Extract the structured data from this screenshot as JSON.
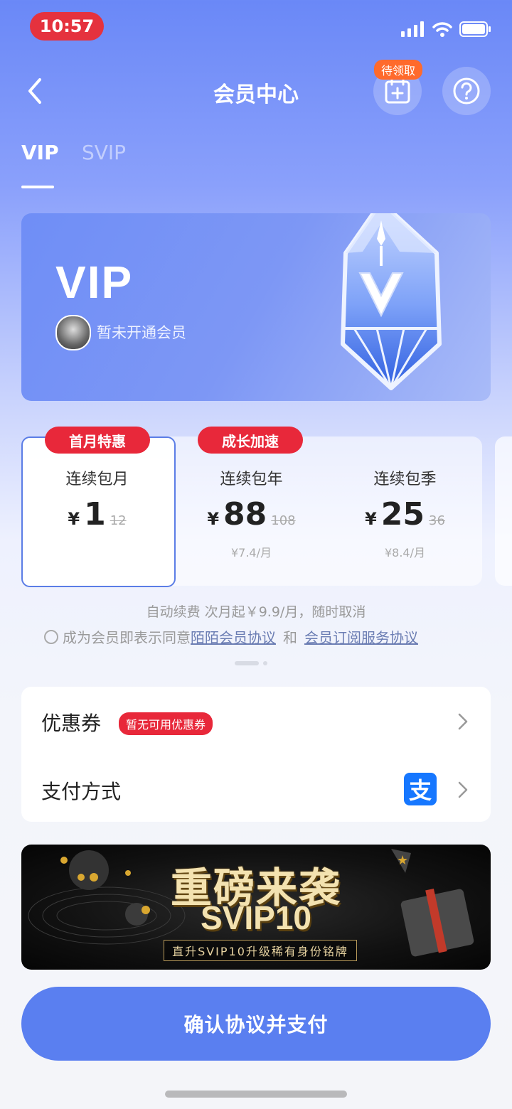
{
  "status_bar": {
    "time": "10:57"
  },
  "header": {
    "title": "会员中心",
    "pending_badge": "待领取"
  },
  "tabs": [
    {
      "label": "VIP"
    },
    {
      "label": "SVIP"
    }
  ],
  "vip_card": {
    "title": "VIP",
    "status": "暂未开通会员"
  },
  "plans": [
    {
      "badge": "首月特惠",
      "name": "连续包月",
      "currency": "¥",
      "price": "1",
      "original": "12",
      "per_month": ""
    },
    {
      "badge": "成长加速",
      "name": "连续包年",
      "currency": "¥",
      "price": "88",
      "original": "108",
      "per_month": "¥7.4/月"
    },
    {
      "badge": "",
      "name": "连续包季",
      "currency": "¥",
      "price": "25",
      "original": "36",
      "per_month": "¥8.4/月"
    }
  ],
  "notes": {
    "renewal": "自动续费 次月起￥9.9/月，随时取消",
    "agree_prefix": "成为会员即表示同意",
    "agreement1": "陌陌会员协议",
    "and": "和",
    "agreement2": "会员订阅服务协议"
  },
  "options": {
    "coupon_label": "优惠券",
    "coupon_badge": "暂无可用优惠券",
    "payment_label": "支付方式",
    "payment_icon_text": "支"
  },
  "banner": {
    "title": "重磅来袭",
    "svip": "SVIP10",
    "subtitle": "直升SVIP10升级稀有身份铭牌"
  },
  "pay_button": "确认协议并支付",
  "colors": {
    "accent": "#5a7ff0",
    "badge_red": "#e8283a",
    "alipay": "#1677ff"
  }
}
